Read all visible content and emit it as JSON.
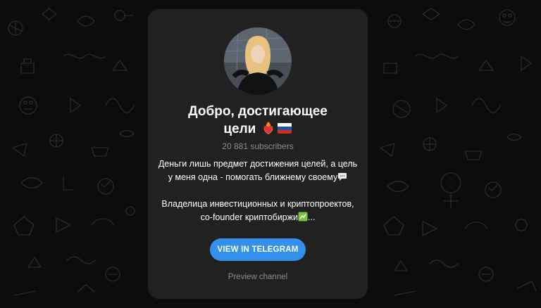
{
  "channel": {
    "title_line1": "Добро, достигающее",
    "title_line2": "цели",
    "title_emojis": [
      "heart-on-fire-icon",
      "russia-flag-icon"
    ],
    "subscribers": "20 881 subscribers",
    "description_line1": "Деньги лишь предмет достижения целей, а цель",
    "description_line2": "у меня одна - помогать ближнему своему",
    "description_line2_emoji": "speech-bubble-icon",
    "description_line3": "Владелица инвестиционных и криптопроектов,",
    "description_line4": "co-founder криптобиржи",
    "description_line4_emoji": "currency-exchange-icon",
    "description_line4_ellipsis": "..."
  },
  "actions": {
    "view_button": "VIEW IN TELEGRAM",
    "preview_link": "Preview channel"
  },
  "colors": {
    "background": "#0c0c0c",
    "card": "#212121",
    "accent": "#3390ec",
    "muted": "#8d8d8d",
    "text": "#ffffff"
  }
}
